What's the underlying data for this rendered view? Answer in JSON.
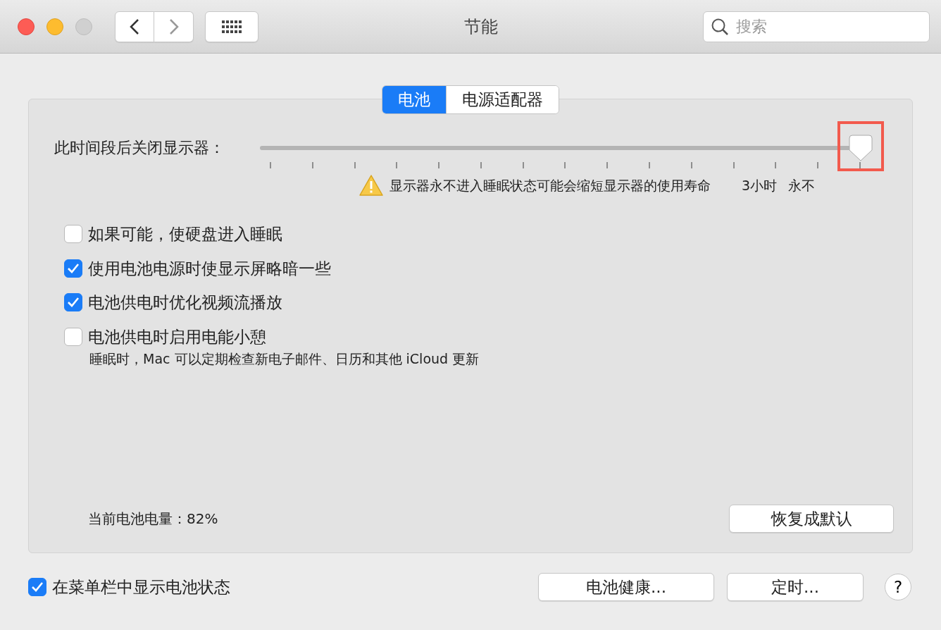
{
  "window": {
    "title": "节能"
  },
  "toolbar": {
    "search": {
      "placeholder": "搜索"
    }
  },
  "tabs": [
    {
      "label": "电池",
      "selected": true
    },
    {
      "label": "电源适配器",
      "selected": false
    }
  ],
  "display_sleep": {
    "label": "此时间段后关闭显示器：",
    "level": 1,
    "warning": "显示器永不进入睡眠状态可能会缩短显示器的使用寿命",
    "tick_labels": [
      "3小时",
      "永不"
    ]
  },
  "options": [
    {
      "label": "如果可能，使硬盘进入睡眠",
      "checked": false
    },
    {
      "label": "使用电池电源时使显示屏略暗一些",
      "checked": true
    },
    {
      "label": "电池供电时优化视频流播放",
      "checked": true
    },
    {
      "label": "电池供电时启用电能小憩",
      "checked": false,
      "note": "睡眠时，Mac 可以定期检查新电子邮件、日历和其他 iCloud 更新"
    }
  ],
  "battery_level": "当前电池电量：82%",
  "restore_button": "恢复成默认",
  "menu_bar_option": {
    "label": "在菜单栏中显示电池状态",
    "checked": true
  },
  "buttons": [
    "电池健康...",
    "定时..."
  ],
  "help_button": "?"
}
